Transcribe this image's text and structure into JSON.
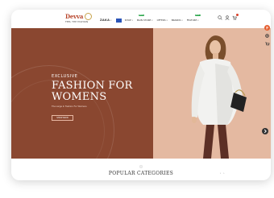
{
  "logo": {
    "name": "Devva",
    "tagline": "FEEL THE FASHION"
  },
  "nav": {
    "brand": "ZAKA",
    "items": [
      {
        "label": "SHOP",
        "badge": ""
      },
      {
        "label": "MAIN STORE",
        "badge": "NEW"
      },
      {
        "label": "OFFERS",
        "badge": ""
      },
      {
        "label": "BRANDS",
        "badge": ""
      },
      {
        "label": "FEATURE",
        "badge": "HOT"
      }
    ]
  },
  "header_icons": [
    "search-icon",
    "user-icon",
    "cart-icon"
  ],
  "hero": {
    "kicker": "EXCLUSIVE",
    "title": "FASHION FOR WOMENS",
    "subtitle": "The Large In Fashion For Womens",
    "button": "SHOP NOW"
  },
  "section": {
    "title": "POPULAR CATEGORIES"
  },
  "pager": {
    "prev": "‹",
    "next": "›"
  },
  "colors": {
    "hero_left": "#8a4730",
    "hero_right": "#e4b9a1",
    "accent": "#e55a2a",
    "badge": "#2fa84f"
  }
}
